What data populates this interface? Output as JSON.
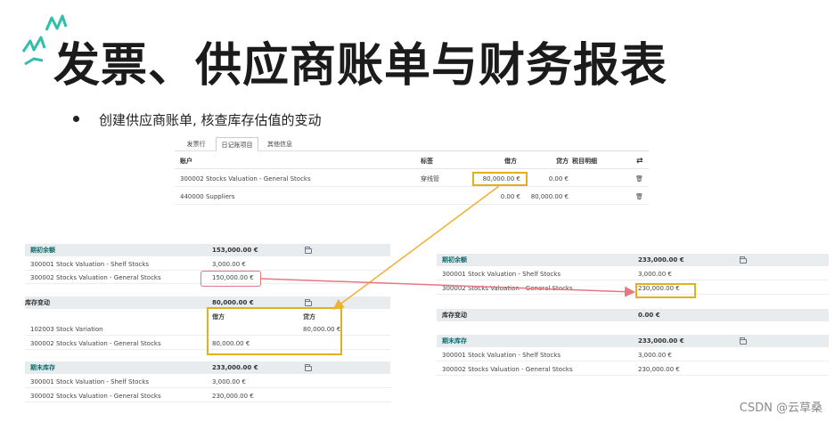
{
  "slide": {
    "title": "发票、供应商账单与财务报表",
    "bullet": "创建供应商账单, 核查库存估值的变动",
    "watermark": "CSDN @云草桑"
  },
  "colors": {
    "teal_accent": "#2fbfa8",
    "highlight_yellow": "#e0b020",
    "highlight_red": "#e07880",
    "section_bg": "#e9ecef"
  },
  "journal": {
    "tabs": [
      "发票行",
      "日记账项目",
      "其他信息"
    ],
    "active_tab": 1,
    "headers": {
      "account": "账户",
      "label": "标签",
      "debit": "借方",
      "credit": "贷方",
      "tax_grid": "税目明细",
      "swap_icon": "swap-icon"
    },
    "rows": [
      {
        "account": "300002 Stocks Valuation - General Stocks",
        "label": "穿线管",
        "debit": "80,000.00 €",
        "credit": "0.00 €"
      },
      {
        "account": "440000 Suppliers",
        "label": "",
        "debit": "0.00 €",
        "credit": "80,000.00 €"
      }
    ]
  },
  "before": {
    "opening": {
      "label": "期初余额",
      "total": "153,000.00 €",
      "rows": [
        {
          "name": "300001 Stock Valuation - Shelf Stocks",
          "value": "3,000.00 €"
        },
        {
          "name": "300002 Stocks Valuation - General Stocks",
          "value": "150,000.00 €"
        }
      ]
    },
    "movement": {
      "label": "库存变动",
      "total": "80,000.00 €",
      "debit_header": "借方",
      "credit_header": "贷方",
      "rows": [
        {
          "name": "102003 Stock Variation",
          "debit": "",
          "credit": "80,000.00 €"
        },
        {
          "name": "300002 Stocks Valuation - General Stocks",
          "debit": "80,000.00 €",
          "credit": ""
        }
      ]
    },
    "closing": {
      "label": "期末库存",
      "total": "233,000.00 €",
      "rows": [
        {
          "name": "300001 Stock Valuation - Shelf Stocks",
          "value": "3,000.00 €"
        },
        {
          "name": "300002 Stocks Valuation - General Stocks",
          "value": "230,000.00 €"
        }
      ]
    }
  },
  "after": {
    "opening": {
      "label": "期初余额",
      "total": "233,000.00 €",
      "rows": [
        {
          "name": "300001 Stock Valuation - Shelf Stocks",
          "value": "3,000.00 €"
        },
        {
          "name": "300002 Stocks Valuation - General Stocks",
          "value": "230,000.00 €"
        }
      ]
    },
    "movement": {
      "label": "库存变动",
      "total": "0.00 €"
    },
    "closing": {
      "label": "期末库存",
      "total": "233,000.00 €",
      "rows": [
        {
          "name": "300001 Stock Valuation - Shelf Stocks",
          "value": "3,000.00 €"
        },
        {
          "name": "300002 Stocks Valuation - General Stocks",
          "value": "230,000.00 €"
        }
      ]
    }
  }
}
